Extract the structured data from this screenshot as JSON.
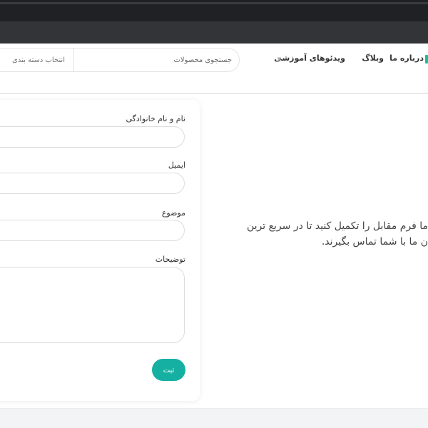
{
  "header": {
    "category_select": "انتخاب دسته بندی",
    "search_placeholder": "جستجوی محصولات",
    "menu": {
      "videos": "ویدئوهای آموزشی",
      "blog": "وبلاگ",
      "about": "درباره ما"
    }
  },
  "form": {
    "name_label": "نام و نام خانوادگی",
    "email_label": "ایمیل",
    "subject_label": "موضوع",
    "description_label": "توضیحات",
    "submit_label": "ثبت"
  },
  "info": {
    "line1": "ما فرم مقابل را تکمیل کنید تا در سریع ترین",
    "line2": "ن ما با شما تماس بگیرند."
  },
  "colors": {
    "accent": "#15b0a2",
    "menu_accent": "#1abc9c"
  }
}
